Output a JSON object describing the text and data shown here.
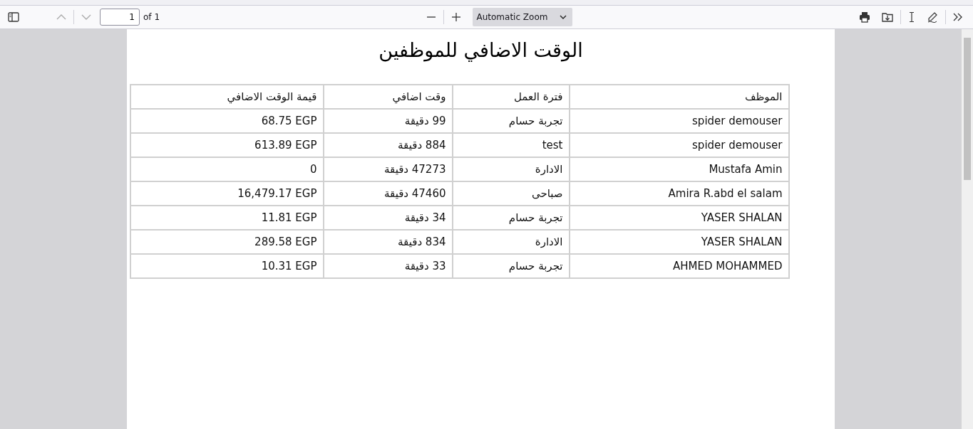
{
  "toolbar": {
    "page_number": "1",
    "page_count": "of 1",
    "zoom": "Automatic Zoom"
  },
  "document": {
    "title": "الوقت الاضافي للموظفين",
    "table": {
      "columns": [
        "الموظف",
        "فترة العمل",
        "وقت اضافي",
        "قيمة الوقت الاضافي"
      ],
      "rows": [
        [
          "spider demouser",
          "تجربة حسام",
          "99 دقيقة",
          "68.75 EGP"
        ],
        [
          "spider demouser",
          "test",
          "884 دقيقة",
          "613.89 EGP"
        ],
        [
          "Mustafa Amin",
          "الادارة",
          "47273 دقيقة",
          "0"
        ],
        [
          "Amira R.abd el salam",
          "صباحى",
          "47460 دقيقة",
          "16,479.17 EGP"
        ],
        [
          "YASER SHALAN",
          "تجربة حسام",
          "34 دقيقة",
          "11.81 EGP"
        ],
        [
          "YASER SHALAN",
          "الادارة",
          "834 دقيقة",
          "289.58 EGP"
        ],
        [
          "AHMED MOHAMMED",
          "تجربة حسام",
          "33 دقيقة",
          "10.31 EGP"
        ]
      ]
    }
  }
}
